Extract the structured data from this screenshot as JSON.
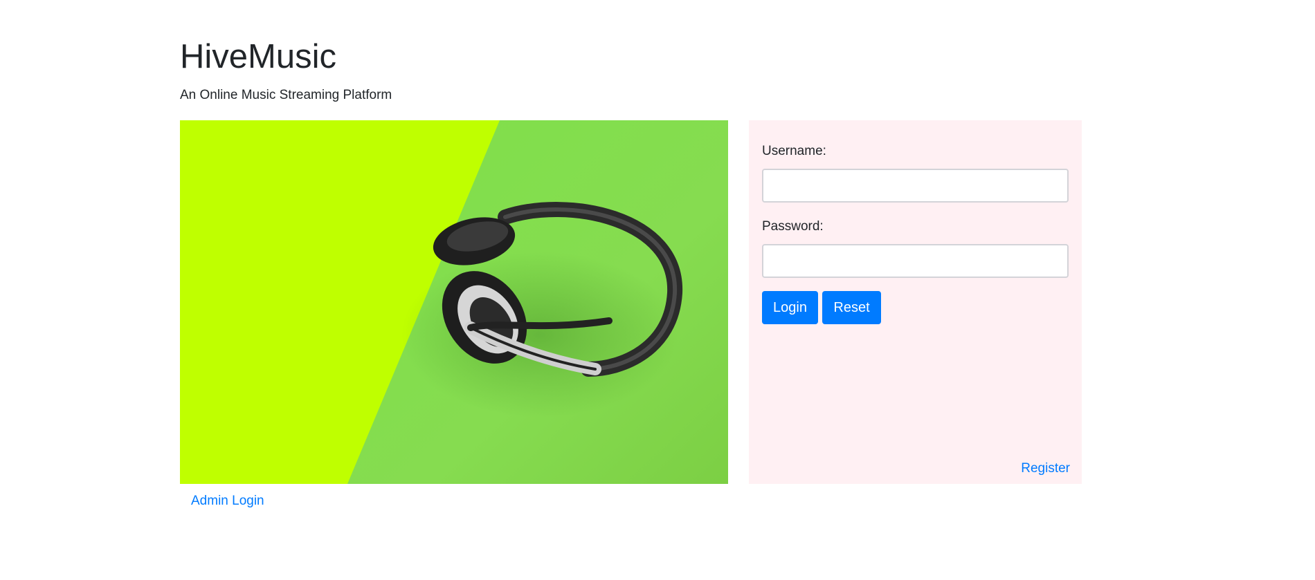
{
  "header": {
    "title": "HiveMusic",
    "subtitle": "An Online Music Streaming Platform"
  },
  "hero": {
    "image_subject": "headphones-on-green-background",
    "colors": {
      "left": "#bfff00",
      "right": "#7fd94e",
      "headphones": "#2a2a2a"
    }
  },
  "login_form": {
    "username_label": "Username:",
    "username_value": "",
    "password_label": "Password:",
    "password_value": "",
    "login_label": "Login",
    "reset_label": "Reset",
    "register_label": "Register",
    "background": "#fff0f3",
    "accent": "#007bff"
  },
  "footer": {
    "admin_login_label": "Admin Login"
  }
}
